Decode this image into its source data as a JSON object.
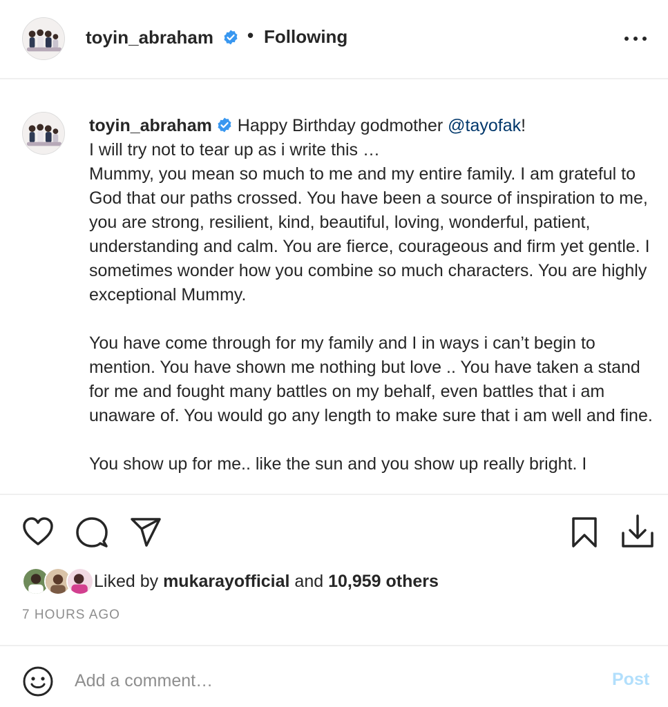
{
  "header": {
    "username": "toyin_abraham",
    "separator": "•",
    "follow_status": "Following",
    "more_icon": "more-horizontal-icon"
  },
  "caption": {
    "username": "toyin_abraham",
    "line1_text": "Happy Birthday godmother ",
    "mention": "@tayofak",
    "line1_end": "!",
    "paragraph1": "I will try not to tear up as i write this …\nMummy, you mean so much to me and my entire family. I am grateful to God that our paths crossed. You have been a source of inspiration to me, you are strong, resilient, kind, beautiful, loving, wonderful, patient, understanding and calm. You are fierce, courageous and firm yet gentle. I sometimes wonder how you combine so much characters. You are highly exceptional Mummy.",
    "paragraph2": "You have come through for my family and I in ways i can’t begin to mention. You have shown me nothing but love .. You have taken a stand for me and fought many battles on my behalf, even battles that i am unaware of. You would go any length to make sure that i am well and fine.",
    "paragraph3": "You show up for me.. like the sun and you show up really bright. I"
  },
  "actions": {
    "like_icon": "heart-icon",
    "comment_icon": "comment-icon",
    "share_icon": "paper-plane-icon",
    "save_icon": "bookmark-icon",
    "download_icon": "download-icon"
  },
  "likes": {
    "prefix": "Liked by ",
    "user": "mukarayofficial",
    "middle": " and ",
    "others": "10,959 others"
  },
  "timestamp": "7 HOURS AGO",
  "comment": {
    "placeholder": "Add a comment…",
    "post_label": "Post",
    "emoji_icon": "smiley-icon"
  },
  "colors": {
    "verified_badge": "#3897f0",
    "mention": "#00376b",
    "post_disabled": "#b2dffc",
    "muted_text": "#8e8e8e",
    "divider": "#efefef"
  }
}
